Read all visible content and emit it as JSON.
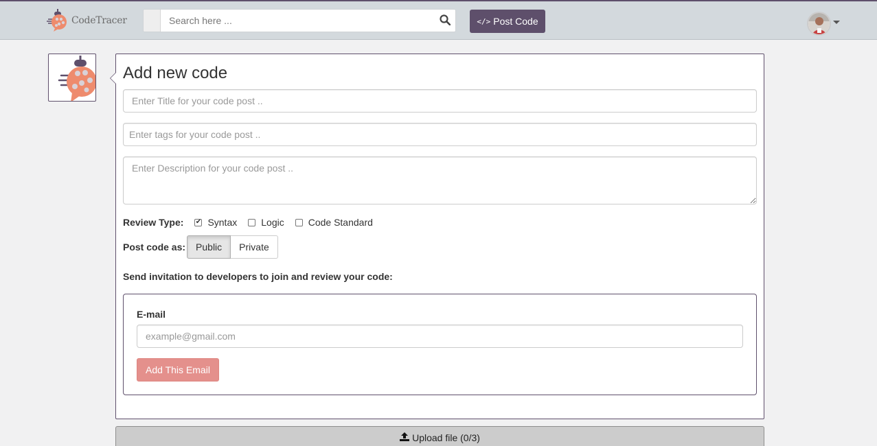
{
  "navbar": {
    "brand_name": "CodeTracer",
    "search_placeholder": "Search here ...",
    "post_code_label": "Post Code",
    "accent_color": "#5e4f6b"
  },
  "form": {
    "heading": "Add new code",
    "title_placeholder": "Enter Title for your code post ..",
    "tags_placeholder": "Enter tags for your code post ..",
    "description_placeholder": "Enter Description for your code post ..",
    "review_type_label": "Review Type:",
    "review_options": [
      {
        "label": "Syntax",
        "checked": true
      },
      {
        "label": "Logic",
        "checked": false
      },
      {
        "label": "Code Standard",
        "checked": false
      }
    ],
    "post_as_label": "Post code as:",
    "post_as_options": [
      "Public",
      "Private"
    ],
    "post_as_selected": "Public",
    "invite_heading": "Send invitation to developers to join and review your code:",
    "email_label": "E-mail",
    "email_placeholder": "example@gmail.com",
    "add_email_label": "Add This Email",
    "add_email_color": "#e4908c"
  },
  "upload": {
    "label": "Upload file (0/3)"
  },
  "icons": {
    "search": "search-icon",
    "code": "code-icon",
    "upload": "upload-icon",
    "caret": "caret-down-icon",
    "logo": "ladybug-logo-icon"
  }
}
